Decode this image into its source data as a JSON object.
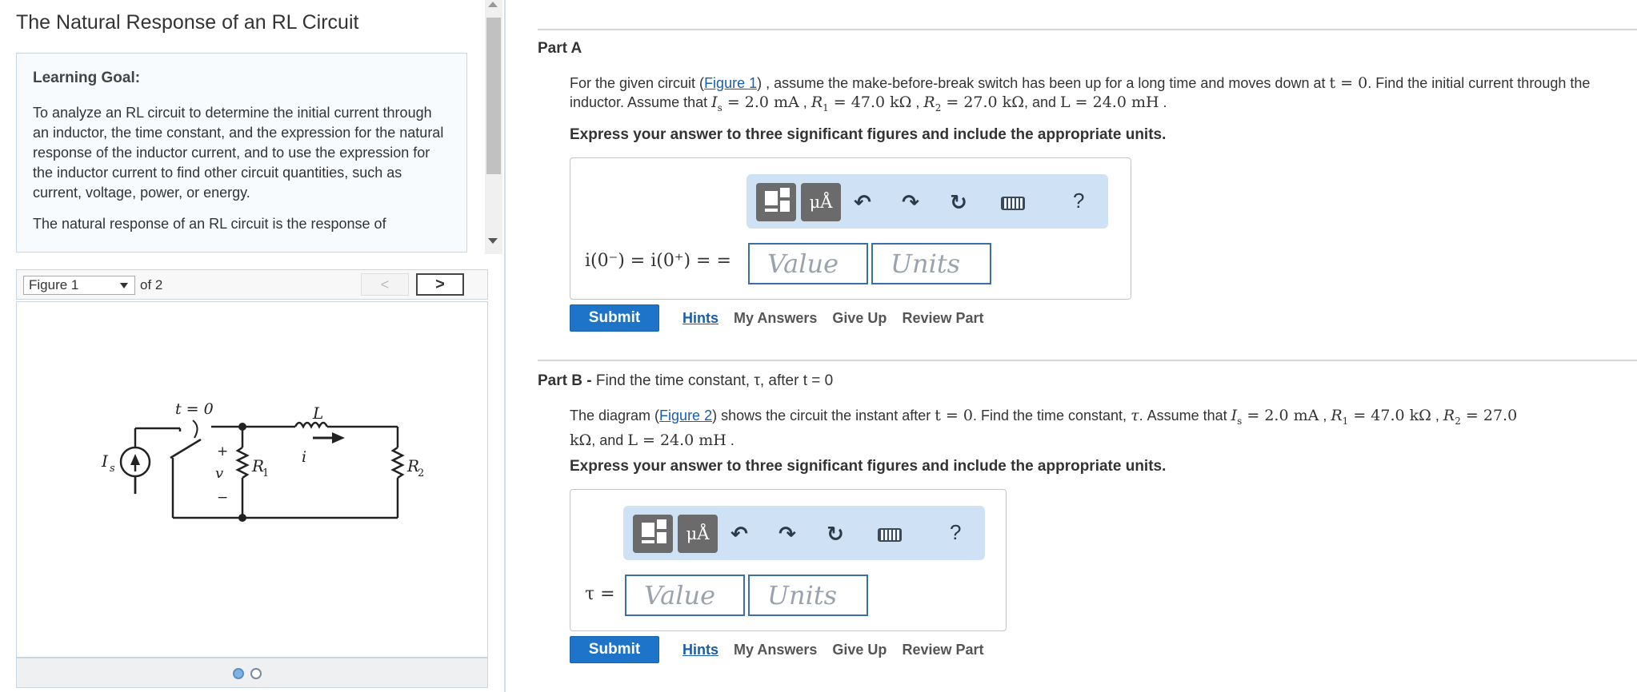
{
  "problem": {
    "title": "The Natural Response of an RL Circuit",
    "goal_heading": "Learning Goal:",
    "goal_text": "To analyze an RL circuit to determine the initial current through an inductor, the time constant, and the expression for the natural response of the inductor current, and to use the expression for the inductor current to find other circuit quantities, such as current, voltage, power, or energy.",
    "natural_text": "The natural response of an RL circuit is the response of"
  },
  "figure": {
    "select_value": "Figure 1",
    "of_text": "of 2",
    "prev": "<",
    "next": ">",
    "labels": {
      "switch": "t = 0",
      "inductor": "L",
      "current": "i",
      "source": "I",
      "source_sub": "s",
      "voltage": "v",
      "plus": "+",
      "minus": "−",
      "r1": "R",
      "r1_sub": "1",
      "r2": "R",
      "r2_sub": "2"
    }
  },
  "toolbar": {
    "units_label": "μÅ",
    "undo": "↶",
    "redo": "↷",
    "reset": "↻",
    "help": "?"
  },
  "partA": {
    "label": "Part A",
    "text_1": "For the given circuit (",
    "figure_link": "Figure 1",
    "text_2": ") , assume the make-before-break switch has been up for a long time and moves down at ",
    "t0": "t = 0",
    "text_3": ". Find the initial current through the inductor. Assume that ",
    "is": "I",
    "is_sub": "s",
    "is_val": " = 2.0 mA",
    "r1": "R",
    "r1_sub": "1",
    "r1_val": " = 47.0 kΩ",
    "r2": "R",
    "r2_sub": "2",
    "r2_val": " = 27.0 kΩ",
    "and_text": ", and ",
    "l_val": "L = 24.0 mH",
    "end": " .",
    "instruction": "Express your answer to three significant figures and include the appropriate units.",
    "answer_label": "i(0⁻) = i(0⁺) = =",
    "value_placeholder": "Value",
    "units_placeholder": "Units",
    "submit": "Submit",
    "hints": "Hints",
    "my_answers": "My Answers",
    "give_up": "Give Up",
    "review_part": "Review Part"
  },
  "partB": {
    "label": "Part B -",
    "subtitle": " Find the time constant, τ, after t = 0",
    "text_1": "The diagram (",
    "figure_link": "Figure 2",
    "text_2": ") shows the circuit the instant after ",
    "t0": "t = 0",
    "text_3": ". Find the time constant, ",
    "tau": "τ",
    "text_4": ". Assume that ",
    "is": "I",
    "is_sub": "s",
    "is_val": " = 2.0 mA",
    "r1": "R",
    "r1_sub": "1",
    "r1_val": " = 47.0 kΩ",
    "r2": "R",
    "r2_sub": "2",
    "r2_val": " = 27.0",
    "line2_a": "kΩ",
    "and_text": ", and ",
    "l_val": "L = 24.0 mH",
    "end": " .",
    "instruction": "Express your answer to three significant figures and include the appropriate units.",
    "answer_label": "τ =",
    "value_placeholder": "Value",
    "units_placeholder": "Units",
    "submit": "Submit",
    "hints": "Hints",
    "my_answers": "My Answers",
    "give_up": "Give Up",
    "review_part": "Review Part"
  }
}
